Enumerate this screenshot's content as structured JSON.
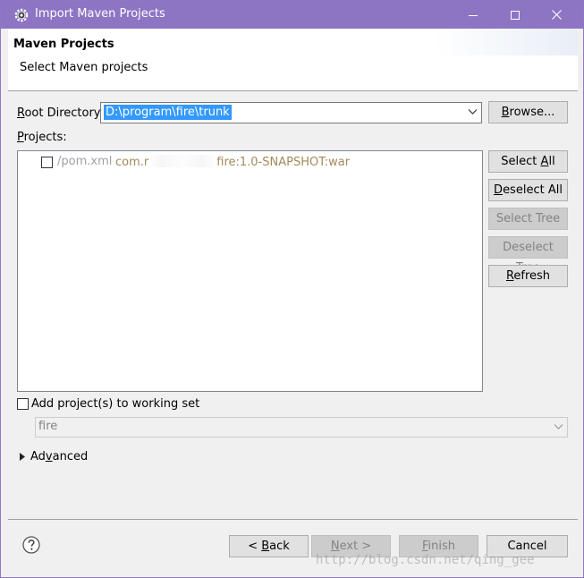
{
  "window": {
    "title": "Import Maven Projects"
  },
  "header": {
    "title": "Maven Projects",
    "subtitle": "Select Maven projects"
  },
  "root_directory": {
    "label_pre": "",
    "label_ul": "R",
    "label_post": "oot Directory:",
    "value": "D:\\program\\fire\\trunk",
    "browse_ul": "B",
    "browse_post": "rowse..."
  },
  "projects": {
    "label_ul": "P",
    "label_post": "rojects:",
    "items": [
      {
        "path": "/pom.xml",
        "gav_pre": "com.r",
        "gav_post": "fire:1.0-SNAPSHOT:war",
        "checked": false
      }
    ]
  },
  "side_buttons": {
    "select_all_pre": "Select ",
    "select_all_ul": "A",
    "select_all_post": "ll",
    "deselect_all_ul": "D",
    "deselect_all_post": "eselect All",
    "select_tree": "Select Tree",
    "deselect_tree": "Deselect Tree",
    "refresh_ul": "R",
    "refresh_post": "efresh"
  },
  "working_set": {
    "label": "Add project(s) to working set",
    "checked": false,
    "value": "fire"
  },
  "advanced": {
    "label_ul": "v",
    "label_pre": "Ad",
    "label_post": "anced"
  },
  "footer": {
    "back_pre": "< ",
    "back_ul": "B",
    "back_post": "ack",
    "next_ul": "N",
    "next_post": "ext >",
    "finish_ul": "F",
    "finish_post": "inish",
    "cancel": "Cancel"
  },
  "watermark": "http://blog.csdn.net/qing_gee",
  "colors": {
    "titlebar": "#8d75c4",
    "selection": "#3399ff",
    "gav_text": "#a08a5a"
  },
  "icons": {
    "app": "maven-gear-icon",
    "minimize": "minimize-icon",
    "maximize": "maximize-icon",
    "close": "close-icon",
    "help": "help-icon"
  }
}
